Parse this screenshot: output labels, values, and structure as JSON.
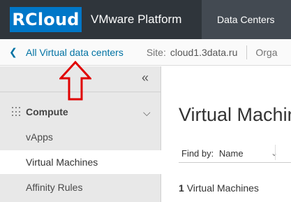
{
  "header": {
    "logo_text": "RCloud",
    "platform_title": "VMware Platform",
    "nav_active": "Data Centers"
  },
  "subnav": {
    "back_link": "All Virtual data centers",
    "site_label": "Site:",
    "site_value": "cloud1.3data.ru",
    "org_label": "Orga"
  },
  "sidebar": {
    "collapse_icon": "double-chevron-left-icon",
    "section_label": "Compute",
    "items": [
      {
        "label": "vApps"
      },
      {
        "label": "Virtual Machines"
      },
      {
        "label": "Affinity Rules"
      }
    ],
    "active_item": "Virtual Machines"
  },
  "main": {
    "title": "Virtual Machines",
    "find_by_label": "Find by:",
    "find_by_value": "Name",
    "vm_count": "1",
    "vm_count_suffix": "Virtual Machines"
  },
  "colors": {
    "header_bg": "#2f353b",
    "logo_bg": "#0077c8",
    "link": "#0072a3",
    "annotation": "#e00000"
  }
}
